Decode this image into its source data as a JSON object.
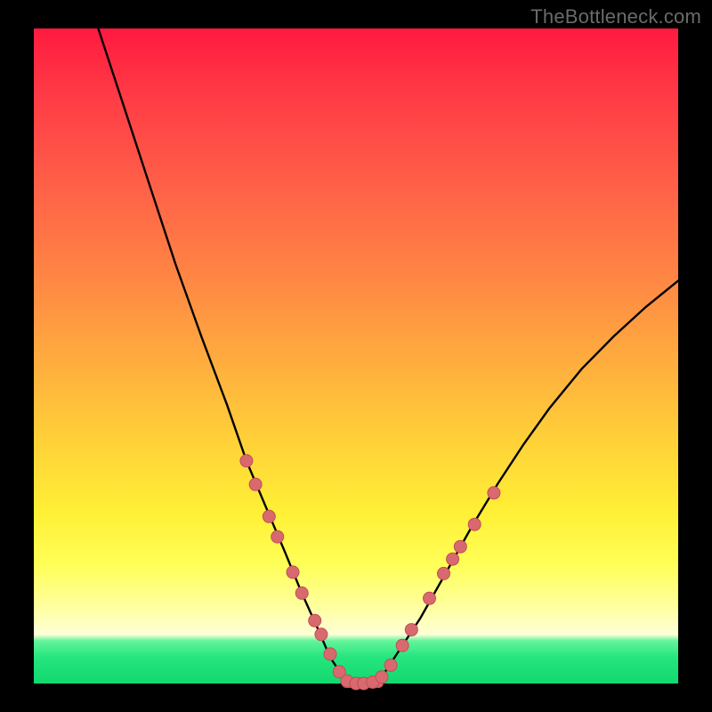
{
  "watermark": "TheBottleneck.com",
  "colors": {
    "frame": "#000000",
    "curve": "#000000",
    "marker_fill": "#d86a6f",
    "marker_stroke": "#c24e55",
    "gradient_top": "#ff1a3f",
    "gradient_bottom": "#11d96e"
  },
  "chart_data": {
    "type": "line",
    "title": "",
    "xlabel": "",
    "ylabel": "",
    "xlim": [
      0,
      100
    ],
    "ylim": [
      0,
      100
    ],
    "grid": false,
    "legend": false,
    "series": [
      {
        "name": "bottleneck-curve",
        "x": [
          10,
          14,
          18,
          22,
          26,
          30,
          33,
          36,
          39,
          41.5,
          44,
          46,
          48,
          50,
          52,
          54,
          56,
          60,
          64,
          68,
          72,
          76,
          80,
          85,
          90,
          95,
          100
        ],
        "y": [
          100,
          88,
          76,
          64,
          53,
          42.5,
          34,
          27,
          20,
          14,
          8.5,
          4,
          1,
          0,
          0,
          1,
          4,
          10,
          17,
          24,
          30.5,
          36.5,
          42,
          48,
          53,
          57.5,
          61.5
        ]
      }
    ],
    "markers": {
      "name": "highlighted-points",
      "points": [
        {
          "x": 33.0,
          "y": 34.0
        },
        {
          "x": 34.4,
          "y": 30.4
        },
        {
          "x": 36.5,
          "y": 25.5
        },
        {
          "x": 37.8,
          "y": 22.4
        },
        {
          "x": 40.2,
          "y": 17.0
        },
        {
          "x": 41.6,
          "y": 13.8
        },
        {
          "x": 43.6,
          "y": 9.6
        },
        {
          "x": 44.6,
          "y": 7.5
        },
        {
          "x": 46.0,
          "y": 4.5
        },
        {
          "x": 47.4,
          "y": 1.8
        },
        {
          "x": 48.6,
          "y": 0.4
        },
        {
          "x": 50.0,
          "y": 0.0
        },
        {
          "x": 51.2,
          "y": 0.0
        },
        {
          "x": 52.6,
          "y": 0.2
        },
        {
          "x": 54.0,
          "y": 1.0
        },
        {
          "x": 55.4,
          "y": 2.8
        },
        {
          "x": 57.2,
          "y": 5.8
        },
        {
          "x": 58.6,
          "y": 8.2
        },
        {
          "x": 61.4,
          "y": 13.0
        },
        {
          "x": 63.6,
          "y": 16.8
        },
        {
          "x": 65.0,
          "y": 19.0
        },
        {
          "x": 66.2,
          "y": 20.9
        },
        {
          "x": 68.4,
          "y": 24.3
        },
        {
          "x": 71.4,
          "y": 29.1
        }
      ]
    },
    "flat_bar": {
      "x0": 47.8,
      "x1": 54.2,
      "y": 0.2
    }
  }
}
